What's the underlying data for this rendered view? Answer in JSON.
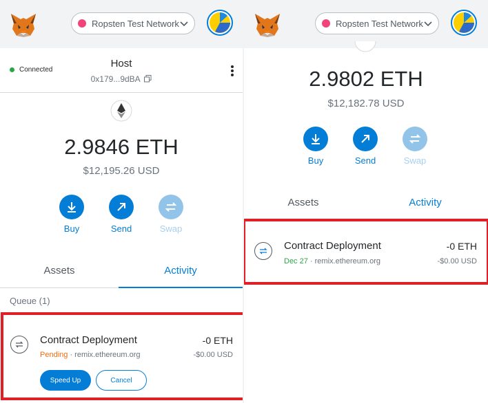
{
  "colors": {
    "accent": "#037dd6",
    "network_dot": "#f0457b",
    "connected": "#28a745",
    "pending": "#f66a0a",
    "highlight_box": "#e01f26"
  },
  "left": {
    "network": "Ropsten Test Network",
    "status": "Connected",
    "account_name": "Host",
    "account_address": "0x179...9dBA",
    "balance": "2.9846 ETH",
    "balance_usd": "$12,195.26 USD",
    "actions": {
      "buy": "Buy",
      "send": "Send",
      "swap": "Swap"
    },
    "tabs": {
      "assets": "Assets",
      "activity": "Activity"
    },
    "queue_label": "Queue (1)",
    "tx": {
      "title": "Contract Deployment",
      "status": "Pending",
      "origin": "· remix.ethereum.org",
      "amount": "-0 ETH",
      "amount_usd": "-$0.00 USD",
      "speed_up": "Speed Up",
      "cancel": "Cancel"
    }
  },
  "right": {
    "network": "Ropsten Test Network",
    "balance": "2.9802 ETH",
    "balance_usd": "$12,182.78 USD",
    "actions": {
      "buy": "Buy",
      "send": "Send",
      "swap": "Swap"
    },
    "tabs": {
      "assets": "Assets",
      "activity": "Activity"
    },
    "tx": {
      "title": "Contract Deployment",
      "date": "Dec 27",
      "origin": "· remix.ethereum.org",
      "amount": "-0 ETH",
      "amount_usd": "-$0.00 USD"
    }
  }
}
